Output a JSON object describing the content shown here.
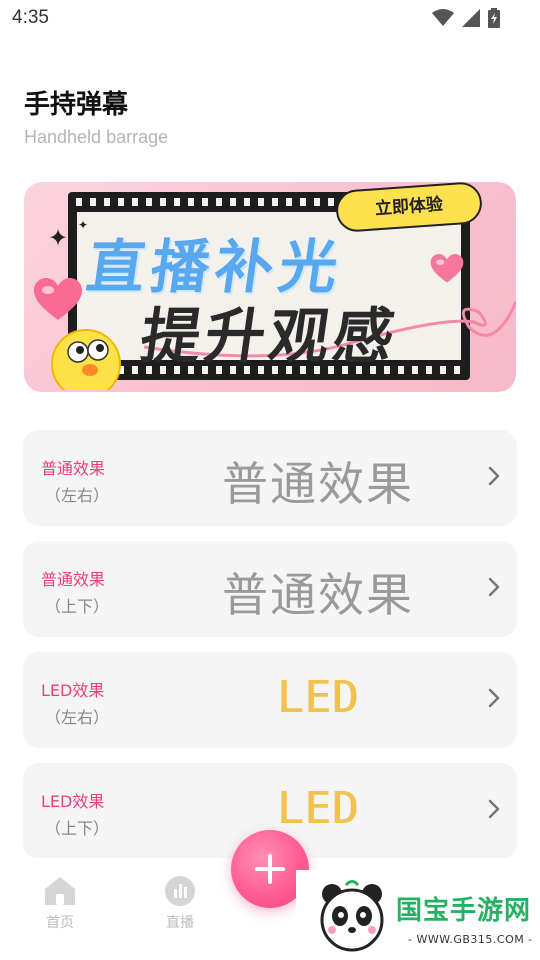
{
  "status_bar": {
    "time": "4:35",
    "icons": [
      "wifi-icon",
      "signal-icon",
      "battery-icon"
    ]
  },
  "header": {
    "title": "手持弹幕",
    "subtitle": "Handheld barrage"
  },
  "banner": {
    "cta": "立即体验",
    "line1": "直播补光",
    "line2": "提升观感"
  },
  "effects": [
    {
      "label": "普通效果",
      "sub": "（左右）",
      "preview": "普通效果",
      "style": "normal"
    },
    {
      "label": "普通效果",
      "sub": "（上下）",
      "preview": "普通效果",
      "style": "normal"
    },
    {
      "label": "LED效果",
      "sub": "（左右）",
      "preview": "LED",
      "style": "led"
    },
    {
      "label": "LED效果",
      "sub": "（上下）",
      "preview": "LED",
      "style": "led"
    }
  ],
  "nav": {
    "items": [
      {
        "label": "首页",
        "icon": "home-icon"
      },
      {
        "label": "直播",
        "icon": "live-chart-icon"
      }
    ],
    "fab_icon": "plus-icon"
  },
  "watermark": {
    "text": "国宝手游网",
    "url": "- WWW.GB315.COM -"
  },
  "colors": {
    "accent": "#ee3f78",
    "led": "#f2c14e",
    "fab": "#ff5d95",
    "watermark": "#26b064"
  }
}
